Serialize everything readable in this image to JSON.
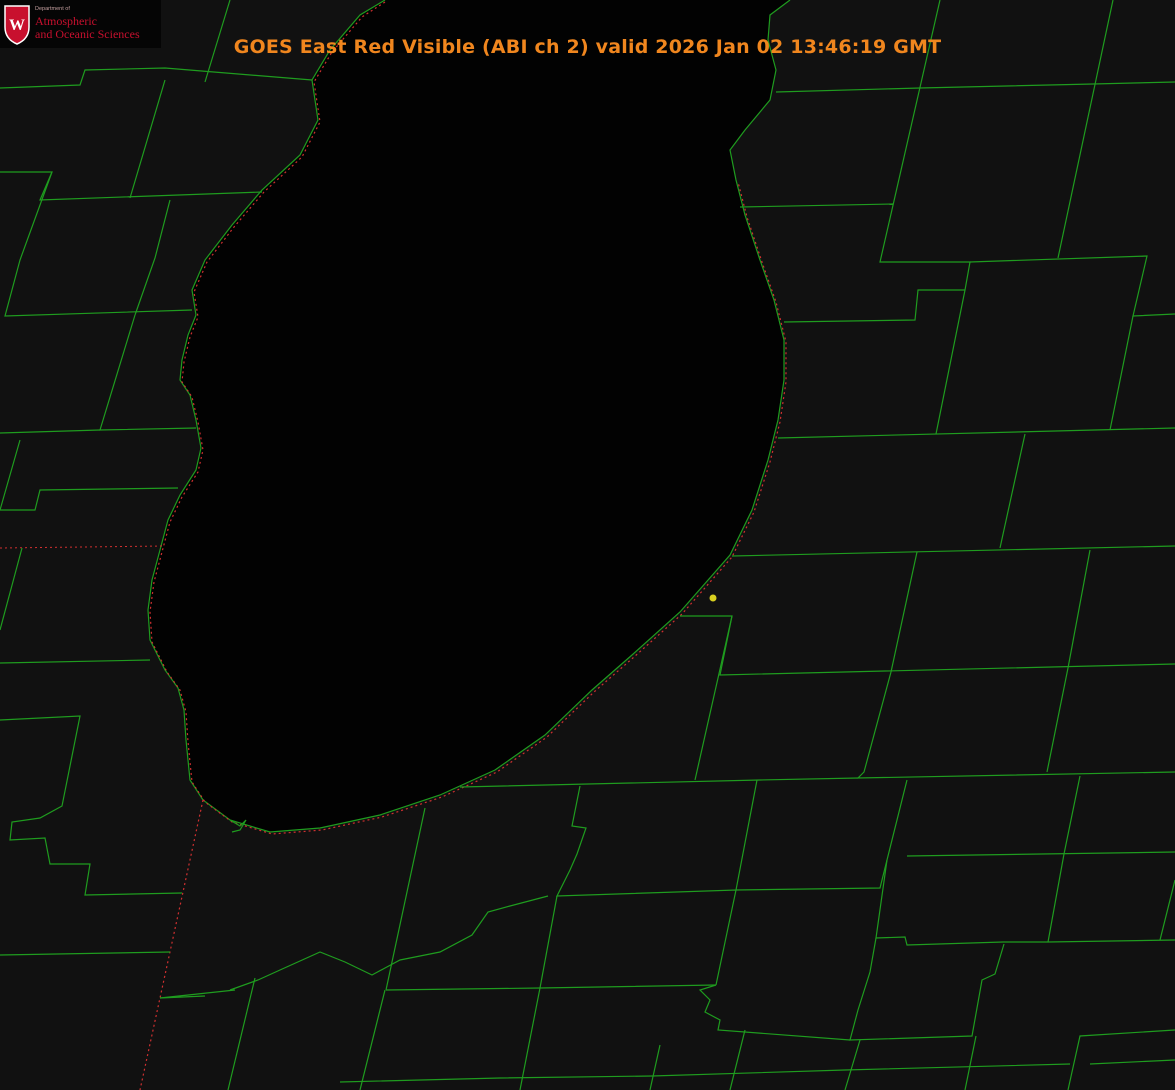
{
  "title": "GOES East Red Visible (ABI ch 2) valid 2026 Jan 02 13:46:19 GMT",
  "logo": {
    "line1": "Department of",
    "line2": "Atmospheric",
    "line3": "and Oceanic Sciences",
    "seal_letter": "W"
  },
  "colors": {
    "background": "#111111",
    "lake": "#020202",
    "county_lines": "#1f9c1f",
    "state_line": "#d03030",
    "title": "#f0861e",
    "logo_red": "#c8102e",
    "marker": "#d8d020"
  },
  "map": {
    "subject": "Lake Michigan (southern basin) with county boundaries",
    "markers": [
      {
        "kind": "station-dot",
        "color": "#d8d020"
      }
    ]
  }
}
